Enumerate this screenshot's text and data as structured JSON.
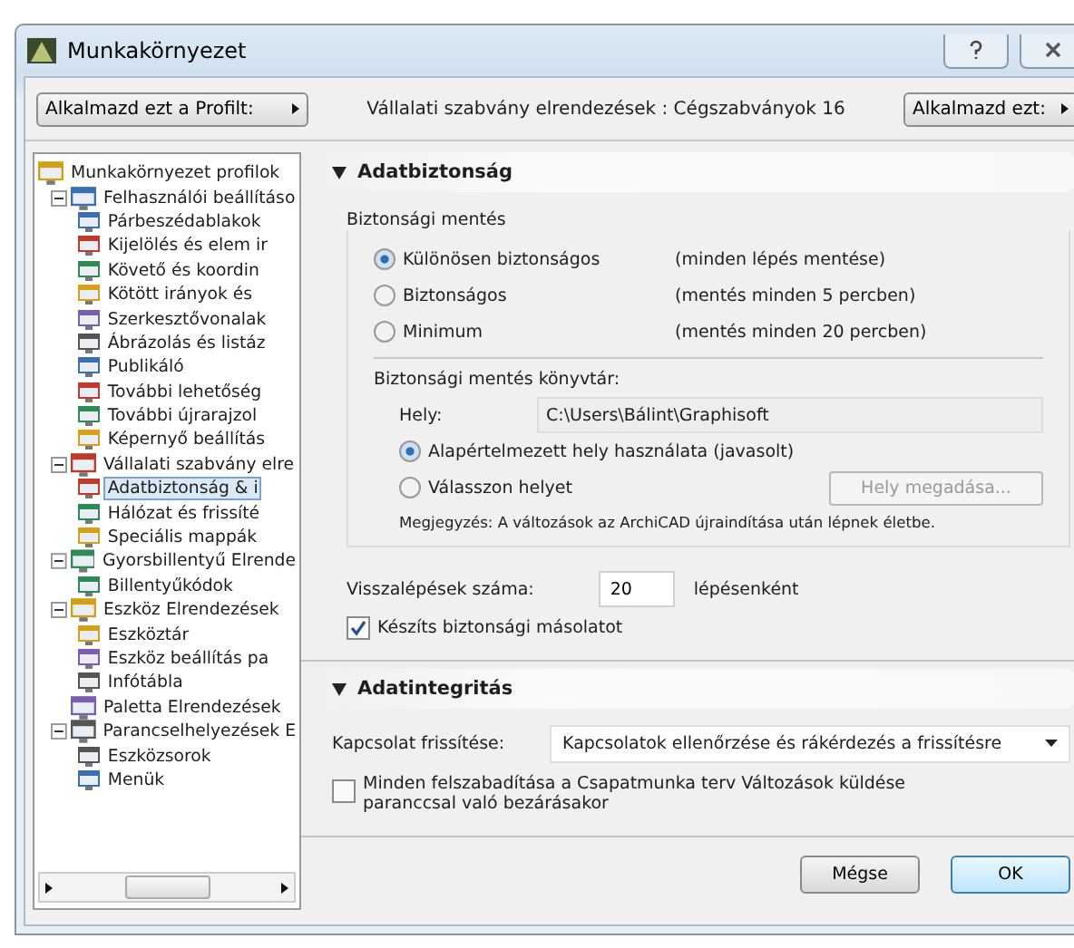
{
  "window": {
    "title": "Munkakörnyezet"
  },
  "toolbar": {
    "apply_profile_button": "Alkalmazd ezt a Profilt:",
    "current_scheme": "Vállalati szabvány elrendezések : Cégszabványok 16",
    "apply_button": "Alkalmazd ezt:"
  },
  "tree": {
    "label": "Munkakörnyezet profilok",
    "children": [
      {
        "label": "Felhasználói beállításo",
        "expanded": true,
        "selected": false,
        "children": [
          {
            "label": "Párbeszédablakok",
            "selected": false
          },
          {
            "label": "Kijelölés és elem ir",
            "selected": false
          },
          {
            "label": "Követő és koordin",
            "selected": false
          },
          {
            "label": "Kötött irányok és",
            "selected": false
          },
          {
            "label": "Szerkesztővonalak",
            "selected": false
          },
          {
            "label": "Ábrázolás és listáz",
            "selected": false
          },
          {
            "label": "Publikáló",
            "selected": false
          },
          {
            "label": "További lehetőség",
            "selected": false
          },
          {
            "label": "További újrarajzol",
            "selected": false
          },
          {
            "label": "Képernyő beállítás",
            "selected": false
          }
        ]
      },
      {
        "label": "Vállalati szabvány elre",
        "expanded": true,
        "selected": false,
        "children": [
          {
            "label": "Adatbiztonság & i",
            "selected": true
          },
          {
            "label": "Hálózat és frissíté",
            "selected": false
          },
          {
            "label": "Speciális mappák",
            "selected": false
          }
        ]
      },
      {
        "label": "Gyorsbillentyű Elrende",
        "expanded": true,
        "selected": false,
        "children": [
          {
            "label": "Billentyűkódok",
            "selected": false
          }
        ]
      },
      {
        "label": "Eszköz Elrendezések",
        "expanded": true,
        "selected": false,
        "children": [
          {
            "label": "Eszköztár",
            "selected": false
          },
          {
            "label": "Eszköz beállítás pa",
            "selected": false
          },
          {
            "label": "Infótábla",
            "selected": false
          }
        ]
      },
      {
        "label": "Paletta Elrendezések",
        "selected": false
      },
      {
        "label": "Parancselhelyezések E",
        "expanded": true,
        "selected": false,
        "children": [
          {
            "label": "Eszközsorok",
            "selected": false
          },
          {
            "label": "Menük",
            "selected": false
          }
        ]
      }
    ]
  },
  "data_safety": {
    "title": "Adatbiztonság",
    "expanded": true,
    "backup": {
      "label": "Biztonsági mentés",
      "options": [
        {
          "label": "Különösen biztonságos",
          "note": "(minden lépés mentése)",
          "selected": true
        },
        {
          "label": "Biztonságos",
          "note": "(mentés minden 5 percben)",
          "selected": false
        },
        {
          "label": "Minimum",
          "note": "(mentés minden 20 percben)",
          "selected": false
        }
      ]
    },
    "folder": {
      "label": "Biztonsági mentés könyvtár:",
      "location_label": "Hely:",
      "location_value": "C:\\Users\\Bálint\\Graphisoft",
      "options": [
        {
          "label": "Alapértelmezett hely használata (javasolt)",
          "selected": true
        },
        {
          "label": "Válasszon helyet",
          "selected": false
        }
      ],
      "browse_button": {
        "label": "Hely megadása...",
        "disabled": true
      },
      "note": "Megjegyzés: A változások az ArchiCAD újraindítása után lépnek életbe."
    },
    "undo": {
      "label": "Visszalépések száma:",
      "value": "20",
      "unit": "lépésenként"
    },
    "backup_copy": {
      "label": "Készíts biztonsági másolatot",
      "checked": true
    }
  },
  "data_integrity": {
    "title": "Adatintegritás",
    "expanded": true,
    "update": {
      "label": "Kapcsolat frissítése:",
      "value": "Kapcsolatok ellenőrzése és rákérdezés a frissítésre"
    },
    "release_all": {
      "label": "Minden felszabadítása a Csapatmunka terv Változások küldése paranccsal való bezárásakor",
      "checked": false
    }
  },
  "buttons": [
    {
      "label": "Mégse",
      "default": false
    },
    {
      "label": "OK",
      "default": true
    }
  ]
}
